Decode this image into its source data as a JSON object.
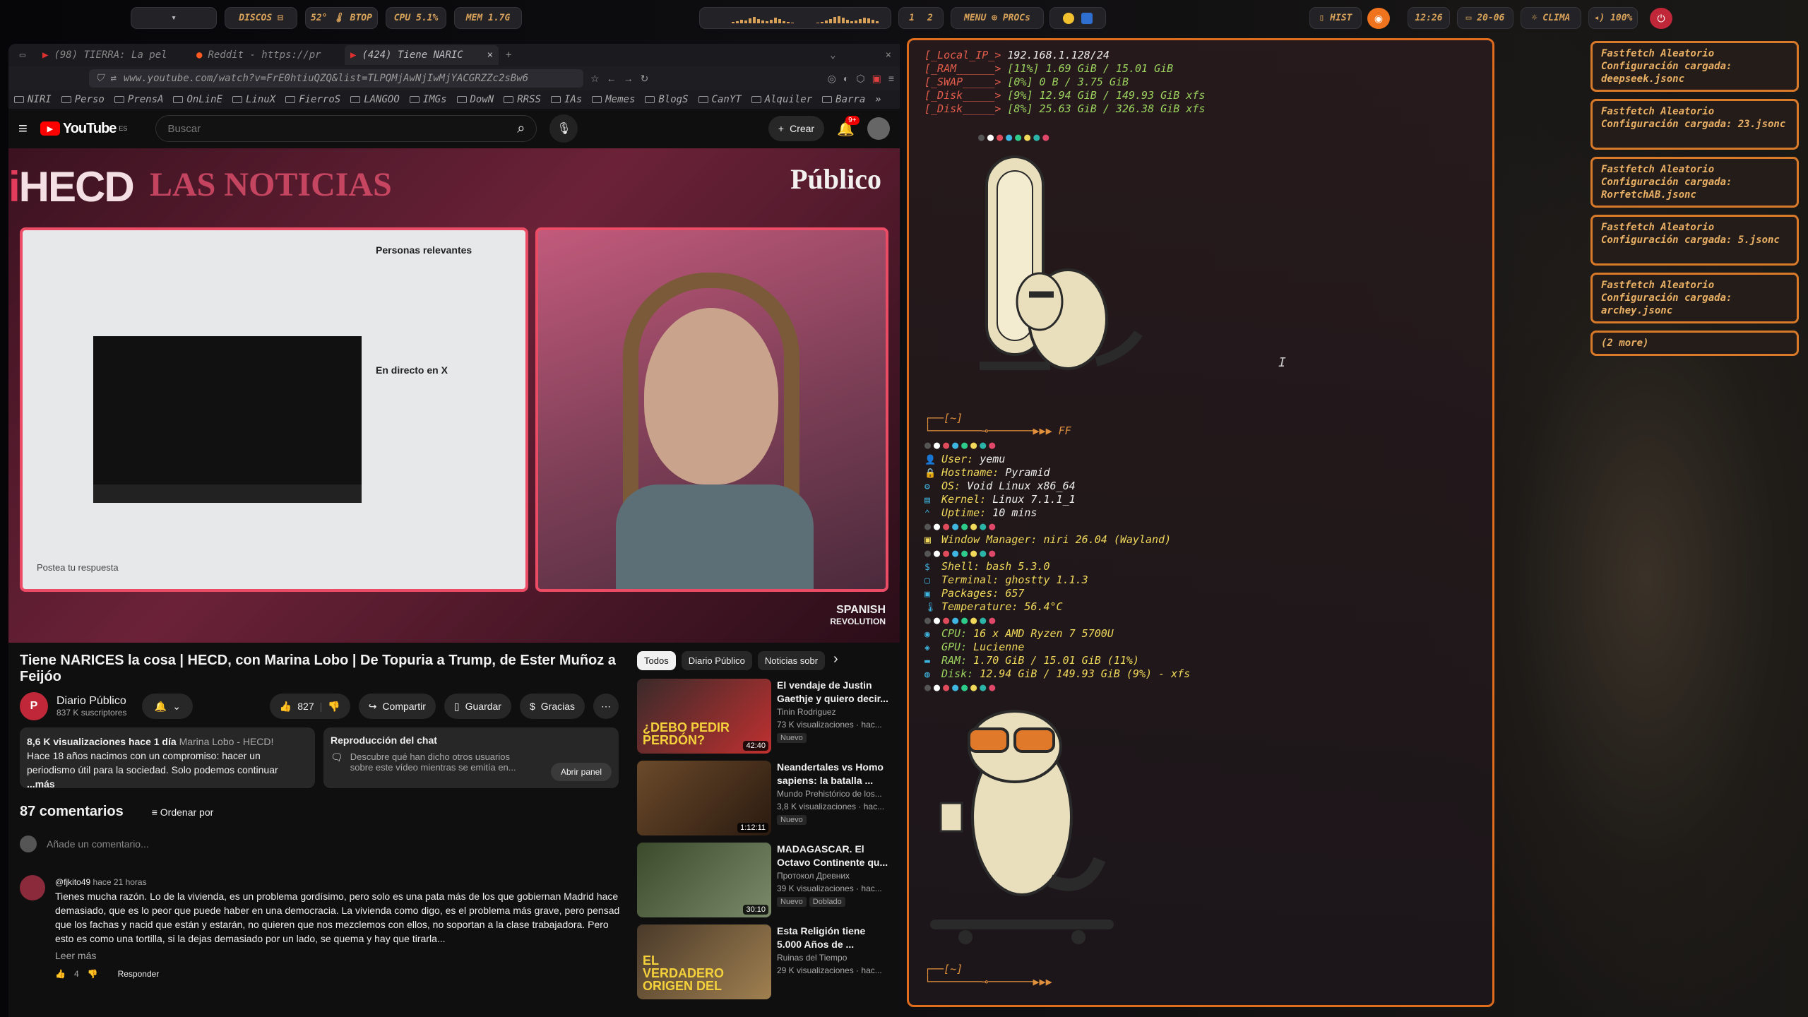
{
  "topbar": {
    "launcher": "▾",
    "discos": "DISCOS ⊟",
    "btop": "52° 🌡 BTOP",
    "cpu": "CPU 5.1%",
    "mem": "MEM 1.7G",
    "ws1": "1",
    "ws2": "2",
    "menu": "MENU ⊕ PROCs",
    "hist": "▯ HIST",
    "time": "12:26",
    "date": "▭ 20-06",
    "clima": "☼ CLIMA",
    "volume": "◂) 100%",
    "colors": {
      "accent": "#d8a15a",
      "orange": "#f0731e",
      "power": "#c0283a"
    }
  },
  "browser": {
    "tabs": [
      "(98) TIERRA: La pel",
      "Reddit - https://pr",
      "(424) Tiene NARIC"
    ],
    "url": "www.youtube.com/watch?v=FrE0htiuQZQ&list=TLPQMjAwNjIwMjYACGRZZc2sBw6",
    "bookmarks": [
      "NIRI",
      "Perso",
      "PrensA",
      "OnLinE",
      "LinuX",
      "FierroS",
      "LANGOO",
      "IMGs",
      "DowN",
      "RRSS",
      "IAs",
      "Memes",
      "BlogS",
      "CanYT",
      "Alquiler",
      "Barra"
    ]
  },
  "youtube": {
    "logo": "YouTube",
    "logo_region": "ES",
    "search_placeholder": "Buscar",
    "create": "Crear",
    "notif_badge": "9+",
    "video_title": "Tiene NARICES la cosa | HECD, con Marina Lobo | De Topuria a Trump, de Ester Muñoz a Feijóo",
    "overlay_hecd": "HECD",
    "overlay_noticias": "LAS NOTICIAS",
    "overlay_publico": "Público",
    "overlay_spanish": "SPANISH",
    "overlay_revolution": "REVOLUTION",
    "overlay_personas": "Personas relevantes",
    "overlay_directo": "En directo en X",
    "overlay_reply": "Postea tu respuesta",
    "channel": "Diario Público",
    "subs": "837 K suscriptores",
    "likes": "827",
    "share": "Compartir",
    "save": "Guardar",
    "thanks": "Gracias",
    "desc_stats": "8,6 K visualizaciones  hace 1 día",
    "desc_tag": "Marina Lobo - HECD!",
    "desc_text": "Hace 18 años nacimos con un compromiso: hacer un periodismo útil para la sociedad. Solo podemos continuar",
    "desc_more": "...más",
    "chat_title": "Reproducción del chat",
    "chat_text": "Descubre qué han dicho otros usuarios sobre este vídeo mientras se emitía en...",
    "chat_btn": "Abrir panel",
    "comments_count": "87 comentarios",
    "sort": "Ordenar por",
    "add_comment": "Añade un comentario...",
    "comment_user": "@fjkito49",
    "comment_time": "hace 21 horas",
    "comment_text": "Tienes mucha razón. Lo de la vivienda, es un problema gordísimo, pero solo es una pata más de los que gobiernan Madrid hace demasiado, que es lo peor que puede haber en una democracia. La vivienda como digo, es el problema más grave, pero pensad que los fachas y nacid que están y estarán, no quieren que nos mezclemos con ellos, no soportan a la clase trabajadora. Pero esto es como una tortilla, si la dejas demasiado por un lado, se quema y hay que tirarla...",
    "read_more": "Leer más",
    "comment_likes": "4",
    "reply": "Responder",
    "chips": [
      "Todos",
      "Diario Público",
      "Noticias sobr"
    ],
    "recs": [
      {
        "title": "El vendaje de Justin Gaethje y quiero decir...",
        "channel": "Tinin Rodriguez",
        "meta": "73 K visualizaciones · hac...",
        "badge": "Nuevo",
        "duration": "42:40",
        "thumb_text": "¿DEBO PEDIR PERDÓN?"
      },
      {
        "title": "Neandertales vs Homo sapiens: la batalla ...",
        "channel": "Mundo Prehistórico de los...",
        "meta": "3,8 K visualizaciones · hac...",
        "badge": "Nuevo",
        "duration": "1:12:11",
        "thumb_text": ""
      },
      {
        "title": "MADAGASCAR. El Octavo Continente qu...",
        "channel": "Протокол Древних",
        "meta": "39 K visualizaciones · hac...",
        "badge": "Nuevo",
        "badge2": "Doblado",
        "duration": "30:10",
        "thumb_text": ""
      },
      {
        "title": "Esta Religión tiene 5.000 Años de ...",
        "channel": "Ruinas del Tiempo",
        "meta": "29 K visualizaciones · hac...",
        "badge": "",
        "duration": "",
        "thumb_text": "EL VERDADERO ORIGEN DEL"
      }
    ]
  },
  "terminal": {
    "top_lines": [
      {
        "label": "[_Local_IP_> ",
        "value": "192.168.1.128/24"
      },
      {
        "label": "[_RAM______> ",
        "value": "[11%] 1.69 GiB / 15.01 GiB"
      },
      {
        "label": "[_SWAP_____> ",
        "value": "[0%] 0 B / 3.75 GiB"
      },
      {
        "label": "[_Disk_____> ",
        "value": "[9%] 12.94 GiB / 149.93 GiB xfs"
      },
      {
        "label": "[_Disk_____> ",
        "value": "[8%] 25.63 GiB / 326.38 GiB xfs"
      }
    ],
    "prompt1": "┌──[~]",
    "prompt1b": "└────────⊸───────▶▶▶ FF",
    "prompt2": "┌──[~]",
    "prompt2b": "└────────⊸───────▶▶▶",
    "info": [
      {
        "icon": "👤",
        "label": "User:",
        "value": "yemu"
      },
      {
        "icon": "🔒",
        "label": "Hostname:",
        "value": "Pyramid"
      },
      {
        "icon": "⚙",
        "label": "OS:",
        "value": "Void Linux  x86_64"
      },
      {
        "icon": "▤",
        "label": "Kernel:",
        "value": "Linux 7.1.1_1"
      },
      {
        "icon": "⌃",
        "label": "Uptime:",
        "value": "10 mins"
      }
    ],
    "wm": {
      "label": "Window Manager:",
      "value": "niri 26.04 (Wayland)"
    },
    "shell": [
      {
        "icon": "$",
        "label": "Shell:",
        "value": "bash 5.3.0"
      },
      {
        "icon": "▢",
        "label": "Terminal:",
        "value": "ghostty 1.1.3"
      },
      {
        "icon": "▣",
        "label": "Packages:",
        "value": "657"
      },
      {
        "icon": "🌡",
        "label": "Temperature:",
        "value": "56.4°C"
      }
    ],
    "hw": [
      {
        "icon": "◉",
        "label": "CPU:",
        "value": "16 x AMD Ryzen 7 5700U"
      },
      {
        "icon": "◈",
        "label": "GPU:",
        "value": "Lucienne"
      },
      {
        "icon": "▬",
        "label": "RAM:",
        "value": "1.70 GiB / 15.01 GiB (11%)"
      },
      {
        "icon": "◍",
        "label": "Disk:",
        "value": "12.94 GiB / 149.93 GiB (9%) - xfs"
      }
    ],
    "palette": [
      "#555555",
      "#ffffff",
      "#e04b5b",
      "#3fb6e0",
      "#2ecc8a",
      "#f0d85a",
      "#2ab3a6",
      "#e0486a"
    ]
  },
  "notifications": [
    {
      "title": "Fastfetch Aleatorio",
      "body": "Configuración cargada: deepseek.jsonc"
    },
    {
      "title": "Fastfetch Aleatorio",
      "body": "Configuración cargada: 23.jsonc"
    },
    {
      "title": "Fastfetch Aleatorio",
      "body": "Configuración cargada: RorfetchAB.jsonc"
    },
    {
      "title": "Fastfetch Aleatorio",
      "body": "Configuración cargada: 5.jsonc"
    },
    {
      "title": "Fastfetch Aleatorio",
      "body": "Configuración cargada: archey.jsonc"
    }
  ],
  "notif_more": "(2 more)"
}
